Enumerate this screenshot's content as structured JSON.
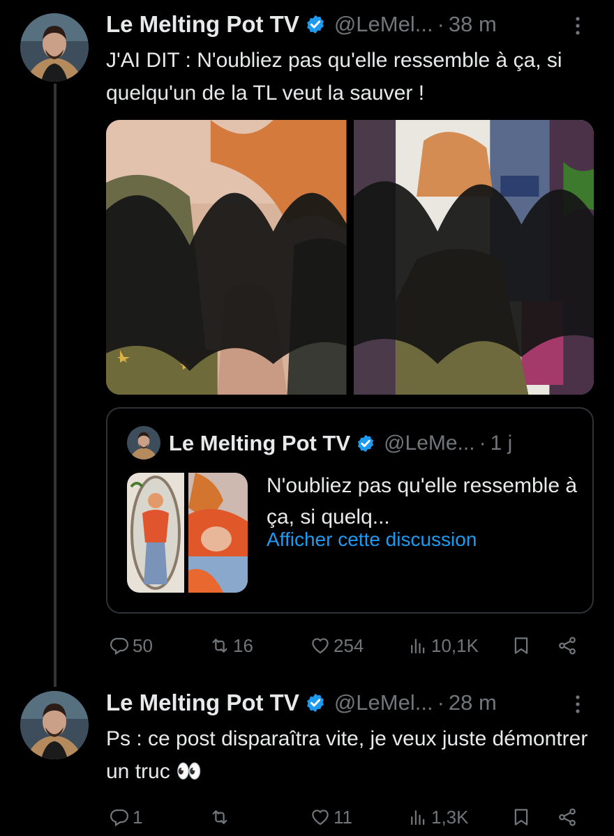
{
  "tweet1": {
    "name": "Le Melting Pot TV",
    "handle": "@LeMel...",
    "dot": "·",
    "time": "38 m",
    "text": "J'AI DIT : N'oubliez pas qu'elle ressemble à ça, si quelqu'un de la TL veut la sauver !",
    "quote": {
      "name": "Le Melting Pot TV",
      "handle": "@LeMe...",
      "dot": "·",
      "time": "1 j",
      "text": "N'oubliez pas qu'elle ressemble à ça, si quelq...",
      "link": "Afficher cette discussion"
    },
    "actions": {
      "replies": "50",
      "retweets": "16",
      "likes": "254",
      "views": "10,1K"
    }
  },
  "tweet2": {
    "name": "Le Melting Pot TV",
    "handle": "@LeMel...",
    "dot": "·",
    "time": "28 m",
    "text": "Ps : ce post disparaîtra vite, je veux juste démontrer un truc 👀",
    "actions": {
      "replies": "1",
      "retweets": "",
      "likes": "11",
      "views": "1,3K"
    }
  },
  "icons": {
    "verified": "verified-badge-icon",
    "more": "more-vertical-icon",
    "reply": "reply-icon",
    "retweet": "retweet-icon",
    "like": "heart-icon",
    "views": "views-icon",
    "bookmark": "bookmark-icon",
    "share": "share-icon"
  },
  "colors": {
    "background": "#000000",
    "text": "#e7e9ea",
    "muted": "#71767b",
    "link": "#1d9bf0",
    "border": "#2f3336"
  }
}
